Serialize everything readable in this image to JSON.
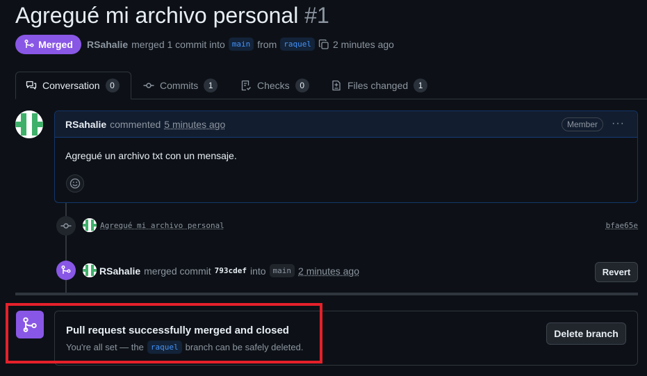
{
  "pr": {
    "title": "Agregué mi archivo personal",
    "number": "#1",
    "status": "Merged",
    "author": "RSahalie",
    "merge_text": "merged 1 commit into",
    "base_branch": "main",
    "from_text": "from",
    "head_branch": "raquel",
    "time": "2 minutes ago"
  },
  "tabs": [
    {
      "label": "Conversation",
      "count": "0",
      "icon": "comment-discussion-icon"
    },
    {
      "label": "Commits",
      "count": "1",
      "icon": "git-commit-icon"
    },
    {
      "label": "Checks",
      "count": "0",
      "icon": "checklist-icon"
    },
    {
      "label": "Files changed",
      "count": "1",
      "icon": "file-diff-icon"
    }
  ],
  "comment": {
    "author": "RSahalie",
    "verb": "commented",
    "time": "5 minutes ago",
    "role": "Member",
    "body": "Agregué un archivo txt con un mensaje."
  },
  "commit_event": {
    "message": "Agregué mi archivo personal",
    "sha": "bfae65e"
  },
  "merge_event": {
    "author": "RSahalie",
    "verb": "merged commit",
    "commit": "793cdef",
    "into": "into",
    "branch": "main",
    "time": "2 minutes ago",
    "revert_label": "Revert"
  },
  "merge_box": {
    "title": "Pull request successfully merged and closed",
    "desc_prefix": "You're all set — the",
    "branch": "raquel",
    "desc_suffix": "branch can be safely deleted.",
    "delete_label": "Delete branch"
  },
  "colors": {
    "merged_purple": "#8957e5",
    "link_blue": "#4493f8",
    "highlight_red": "#e5202a"
  }
}
